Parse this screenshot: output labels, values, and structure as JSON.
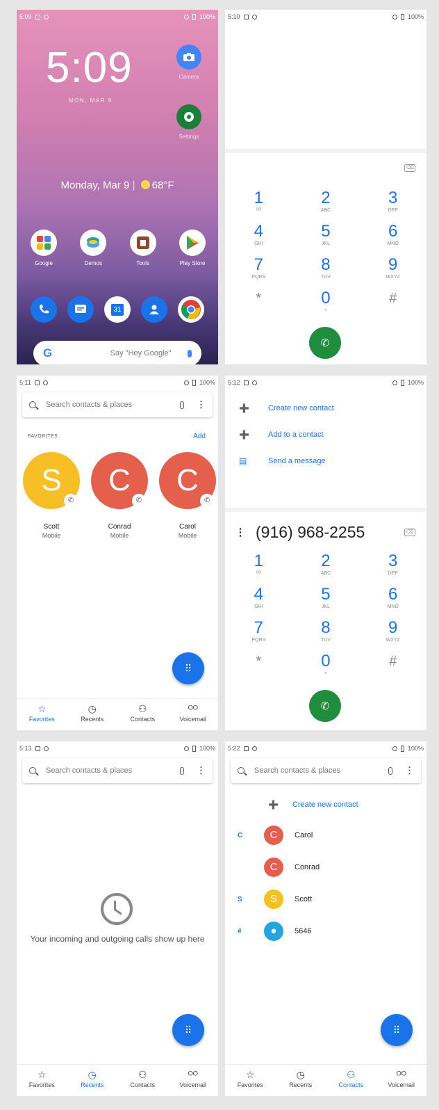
{
  "colors": {
    "accent": "#1a73e8",
    "call_green": "#1e8e3e",
    "scott": "#f6bf26",
    "carol": "#e4604d",
    "conrad": "#e4604d",
    "unknown": "#24a4e0"
  },
  "status_bars": [
    {
      "time": "5:09",
      "battery": "100%"
    },
    {
      "time": "5:10",
      "battery": "100%"
    },
    {
      "time": "5:11",
      "battery": "100%"
    },
    {
      "time": "5:12",
      "battery": "100%"
    },
    {
      "time": "5:13",
      "battery": "100%"
    },
    {
      "time": "5:22",
      "battery": "100%"
    }
  ],
  "home": {
    "clock": "5:09",
    "clock_date": "MON, MAR 9",
    "weather": "Monday, Mar 9",
    "temp": "68°F",
    "side_apps": [
      {
        "label": "Camera",
        "icon": "camera-icon"
      },
      {
        "label": "Settings",
        "icon": "settings-icon"
      }
    ],
    "apps": [
      {
        "label": "Google",
        "icon": "google-folder-icon"
      },
      {
        "label": "Demos",
        "icon": "demos-icon"
      },
      {
        "label": "Tools",
        "icon": "tools-icon"
      },
      {
        "label": "Play Store",
        "icon": "play-store-icon"
      }
    ],
    "dock": [
      {
        "icon": "phone-icon"
      },
      {
        "icon": "messages-icon"
      },
      {
        "icon": "calendar-icon",
        "text": "31"
      },
      {
        "icon": "contacts-icon"
      },
      {
        "icon": "chrome-icon"
      }
    ],
    "search_logo": "G",
    "search_hint": "Say \"Hey Google\""
  },
  "dialer": {
    "keys": [
      {
        "num": "1",
        "sub": "ᴼᴼ"
      },
      {
        "num": "2",
        "sub": "ABC"
      },
      {
        "num": "3",
        "sub": "DEF"
      },
      {
        "num": "4",
        "sub": "GHI"
      },
      {
        "num": "5",
        "sub": "JKL"
      },
      {
        "num": "6",
        "sub": "MNO"
      },
      {
        "num": "7",
        "sub": "PQRS"
      },
      {
        "num": "8",
        "sub": "TUV"
      },
      {
        "num": "9",
        "sub": "WXYZ"
      },
      {
        "num": "*",
        "sub": ""
      },
      {
        "num": "0",
        "sub": "+"
      },
      {
        "num": "#",
        "sub": ""
      }
    ],
    "backspace": "⌫",
    "call_icon": "✆"
  },
  "search": {
    "placeholder": "Search contacts & places"
  },
  "favorites": {
    "heading": "FAVORITES",
    "add": "Add",
    "items": [
      {
        "initial": "S",
        "name": "Scott",
        "type": "Mobile"
      },
      {
        "initial": "C",
        "name": "Conrad",
        "type": "Mobile"
      },
      {
        "initial": "C",
        "name": "Carol",
        "type": "Mobile"
      }
    ]
  },
  "tabs": [
    {
      "icon": "☆",
      "label": "Favorites"
    },
    {
      "icon": "◷",
      "label": "Recents"
    },
    {
      "icon": "⚇",
      "label": "Contacts"
    },
    {
      "icon": "ᴼᴼ",
      "label": "Voicemail"
    }
  ],
  "actions": [
    {
      "icon": "➕",
      "label": "Create new contact"
    },
    {
      "icon": "➕",
      "label": "Add to a contact"
    },
    {
      "icon": "▤",
      "label": "Send a message"
    }
  ],
  "typed_number": "(916) 968-2255",
  "recents": {
    "empty_text": "Your incoming and outgoing calls show up here"
  },
  "contacts": {
    "create": "Create new contact",
    "items": [
      {
        "letter": "C",
        "initial": "C",
        "name": "Carol"
      },
      {
        "letter": "",
        "initial": "C",
        "name": "Conrad"
      },
      {
        "letter": "S",
        "initial": "S",
        "name": "Scott"
      },
      {
        "letter": "#",
        "initial": "●",
        "name": "5646"
      }
    ]
  }
}
